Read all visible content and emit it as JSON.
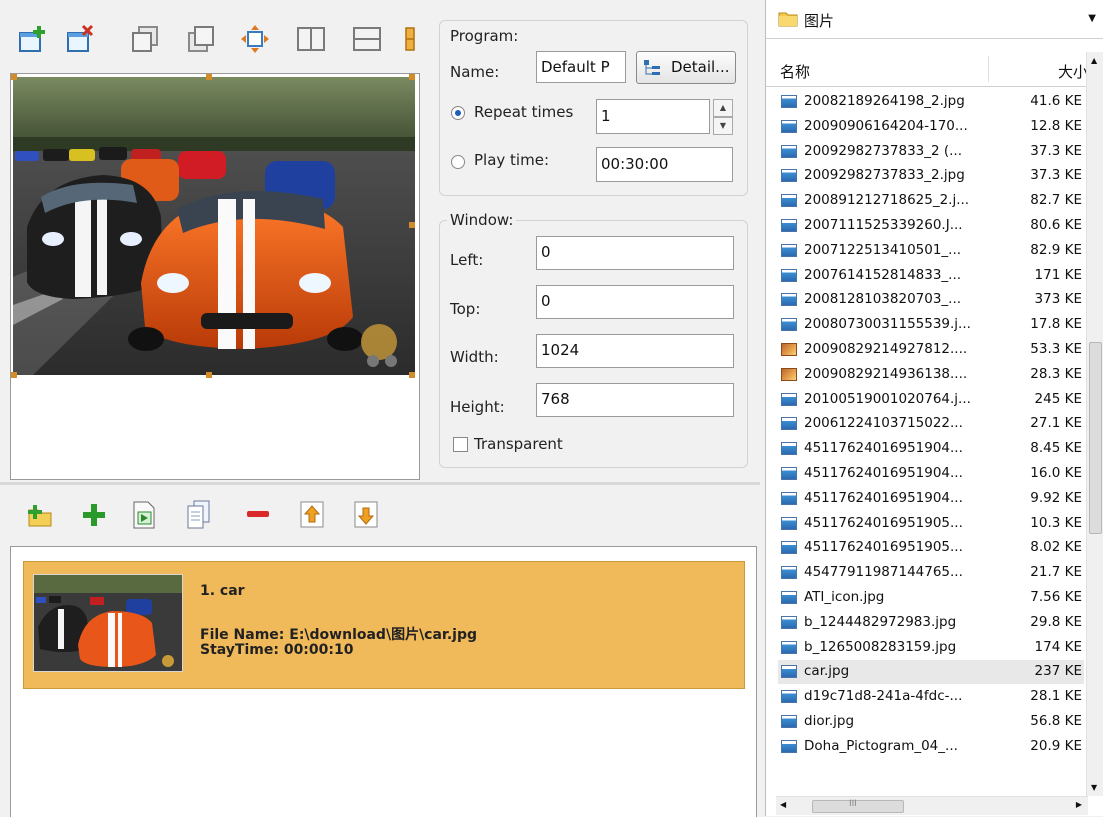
{
  "program": {
    "group_title": "Program:",
    "name_label": "Name:",
    "name_value": "Default P",
    "detail_button": "Detail...",
    "repeat_label": "Repeat times",
    "repeat_value": "1",
    "playtime_label": "Play time:",
    "playtime_value": "00:30:00",
    "mode_selected": "repeat"
  },
  "window": {
    "group_title": "Window:",
    "left_label": "Left:",
    "left_value": "0",
    "top_label": "Top:",
    "top_value": "0",
    "width_label": "Width:",
    "width_value": "1024",
    "height_label": "Height:",
    "height_value": "768",
    "transparent_label": "Transparent",
    "transparent_checked": false
  },
  "toolbar_top": [
    "add-window-icon",
    "delete-window-icon",
    "window-front-icon",
    "window-back-icon",
    "maximize-window-icon",
    "split-vertical-icon",
    "split-horizontal-icon",
    "layout-more-icon"
  ],
  "toolbar_bottom": [
    "add-folder-icon",
    "add-item-icon",
    "insert-file-icon",
    "copy-item-icon",
    "remove-item-icon",
    "move-up-icon",
    "move-down-icon"
  ],
  "playlist": {
    "item_title": "1. car",
    "file_name": "File Name: E:\\download\\图片\\car.jpg",
    "stay_time": "StayTime: 00:00:10"
  },
  "files": {
    "folder": "图片",
    "col_name": "名称",
    "col_size": "大小",
    "hscroll_label": "III",
    "items": [
      {
        "name": "20082189264198_2.jpg",
        "size": "41.6 KE",
        "icon": "image-file-icon"
      },
      {
        "name": "20090906164204-170...",
        "size": "12.8 KE",
        "icon": "image-file-icon"
      },
      {
        "name": "20092982737833_2 (...",
        "size": "37.3 KE",
        "icon": "image-file-icon"
      },
      {
        "name": "20092982737833_2.jpg",
        "size": "37.3 KE",
        "icon": "image-file-icon"
      },
      {
        "name": "200891212718625_2.j...",
        "size": "82.7 KE",
        "icon": "image-file-icon"
      },
      {
        "name": "2007111525339260.J...",
        "size": "80.6 KE",
        "icon": "image-file-icon"
      },
      {
        "name": "2007122513410501_...",
        "size": "82.9 KE",
        "icon": "image-file-icon"
      },
      {
        "name": "2007614152814833_...",
        "size": "171 KE",
        "icon": "image-file-icon"
      },
      {
        "name": "2008128103820703_...",
        "size": "373 KE",
        "icon": "image-file-icon"
      },
      {
        "name": "20080730031155539.j...",
        "size": "17.8 KE",
        "icon": "image-file-icon"
      },
      {
        "name": "20090829214927812....",
        "size": "53.3 KE",
        "icon": "png-file-icon"
      },
      {
        "name": "20090829214936138....",
        "size": "28.3 KE",
        "icon": "png-file-icon"
      },
      {
        "name": "20100519001020764.j...",
        "size": "245 KE",
        "icon": "image-file-icon"
      },
      {
        "name": "20061224103715022...",
        "size": "27.1 KE",
        "icon": "image-file-icon"
      },
      {
        "name": "45117624016951904...",
        "size": "8.45 KE",
        "icon": "image-file-icon"
      },
      {
        "name": "45117624016951904...",
        "size": "16.0 KE",
        "icon": "image-file-icon"
      },
      {
        "name": "45117624016951904...",
        "size": "9.92 KE",
        "icon": "image-file-icon"
      },
      {
        "name": "45117624016951905...",
        "size": "10.3 KE",
        "icon": "image-file-icon"
      },
      {
        "name": "45117624016951905...",
        "size": "8.02 KE",
        "icon": "image-file-icon"
      },
      {
        "name": "45477911987144765...",
        "size": "21.7 KE",
        "icon": "image-file-icon"
      },
      {
        "name": "ATI_icon.jpg",
        "size": "7.56 KE",
        "icon": "image-file-icon"
      },
      {
        "name": "b_1244482972983.jpg",
        "size": "29.8 KE",
        "icon": "image-file-icon"
      },
      {
        "name": "b_1265008283159.jpg",
        "size": "174 KE",
        "icon": "image-file-icon"
      },
      {
        "name": "car.jpg",
        "size": "237 KE",
        "icon": "image-file-icon",
        "selected": true
      },
      {
        "name": "d19c71d8-241a-4fdc-...",
        "size": "28.1 KE",
        "icon": "image-file-icon"
      },
      {
        "name": "dior.jpg",
        "size": "56.8 KE",
        "icon": "image-file-icon"
      },
      {
        "name": "Doha_Pictogram_04_...",
        "size": "20.9 KE",
        "icon": "image-file-icon"
      }
    ]
  }
}
